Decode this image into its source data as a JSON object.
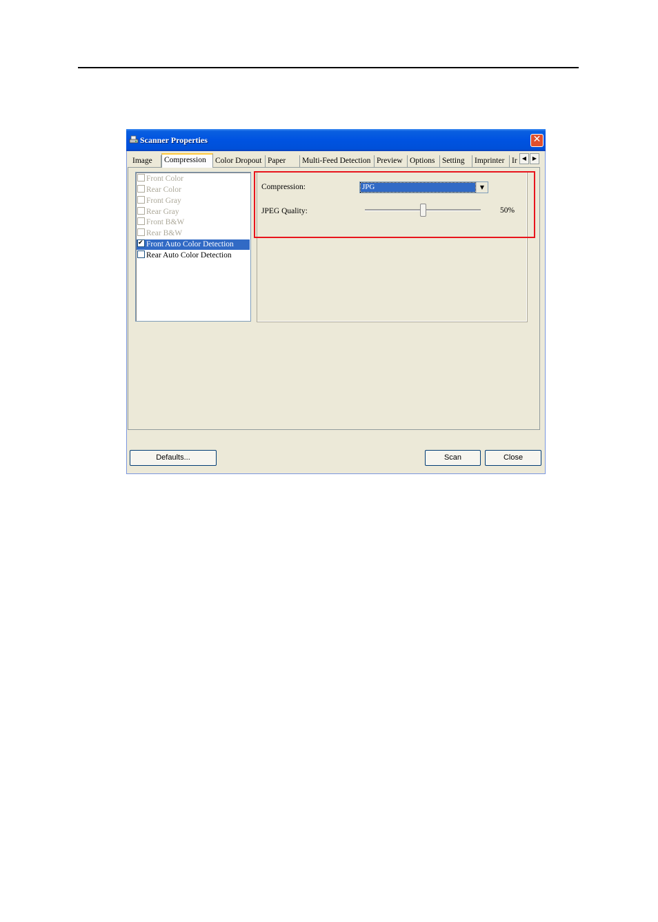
{
  "window": {
    "title": "Scanner Properties"
  },
  "tabs": [
    "Image",
    "Compression",
    "Color Dropout",
    "Paper",
    "Multi-Feed Detection",
    "Preview",
    "Options",
    "Setting",
    "Imprinter",
    "Ir"
  ],
  "active_tab": "Compression",
  "image_list": [
    {
      "label": "Front Color",
      "checked": false,
      "enabled": false
    },
    {
      "label": "Rear Color",
      "checked": false,
      "enabled": false
    },
    {
      "label": "Front Gray",
      "checked": false,
      "enabled": false
    },
    {
      "label": "Rear Gray",
      "checked": false,
      "enabled": false
    },
    {
      "label": "Front B&W",
      "checked": false,
      "enabled": false
    },
    {
      "label": "Rear B&W",
      "checked": false,
      "enabled": false
    },
    {
      "label": "Front Auto Color Detection",
      "checked": true,
      "enabled": true,
      "selected": true
    },
    {
      "label": "Rear Auto Color Detection",
      "checked": false,
      "enabled": true
    }
  ],
  "compression": {
    "label": "Compression:",
    "value": "JPG"
  },
  "jpeg_quality": {
    "label": "JPEG Quality:",
    "value_text": "50%",
    "level": 0.5
  },
  "buttons": {
    "defaults": "Defaults...",
    "scan": "Scan",
    "close": "Close"
  },
  "colors": {
    "highlight": "#e8141c",
    "selection": "#316ac5"
  }
}
